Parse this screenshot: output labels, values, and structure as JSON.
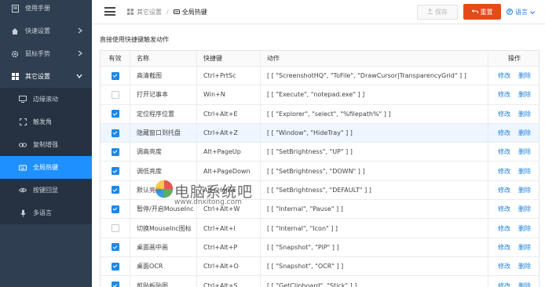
{
  "sidebar": {
    "items": [
      {
        "label": "使用手册",
        "icon": "document-icon",
        "level": "top"
      },
      {
        "label": "快速设置",
        "icon": "home-icon",
        "level": "top",
        "caret": "chevron-right-icon"
      },
      {
        "label": "鼠标手势",
        "icon": "gear-icon",
        "level": "top",
        "caret": "chevron-right-icon"
      },
      {
        "label": "其它设置",
        "icon": "grid-icon",
        "level": "top",
        "caret": "chevron-down-icon",
        "open": true
      },
      {
        "label": "边缘滚动",
        "icon": "monitor-icon",
        "level": "sub"
      },
      {
        "label": "触发角",
        "icon": "corners-icon",
        "level": "sub"
      },
      {
        "label": "复制增强",
        "icon": "link-icon",
        "level": "sub"
      },
      {
        "label": "全局热键",
        "icon": "keyboard-icon",
        "level": "sub",
        "active": true
      },
      {
        "label": "按键回显",
        "icon": "eye-icon",
        "level": "sub"
      },
      {
        "label": "多语言",
        "icon": "microphone-icon",
        "level": "sub"
      }
    ]
  },
  "header": {
    "breadcrumb_parent": "其它设置",
    "breadcrumb_sep": "/",
    "breadcrumb_current": "全局热键",
    "save_label": "保存",
    "reset_label": "重置",
    "lang_label": "语言"
  },
  "main": {
    "description": "直接使用快捷键触发动作",
    "columns": [
      "有效",
      "名称",
      "快捷键",
      "动作",
      "操作"
    ],
    "edit_label": "修改",
    "delete_label": "删除",
    "rows": [
      {
        "enabled": true,
        "name": "高清截图",
        "key": "Ctrl+PrtSc",
        "action": "[ [ \"ScreenshotHQ\", \"ToFile\", \"DrawCursor|TransparencyGrid\" ] ]"
      },
      {
        "enabled": false,
        "name": "打开记事本",
        "key": "Win+N",
        "action": "[ [ \"Execute\", \"notepad.exe\" ] ]"
      },
      {
        "enabled": true,
        "name": "定位程序位置",
        "key": "Ctrl+Alt+E",
        "action": "[ [ \"Explorer\", \"select\", \"%filepath%\" ] ]"
      },
      {
        "enabled": true,
        "name": "隐藏窗口到托盘",
        "key": "Ctrl+Alt+Z",
        "action": "[ [ \"Window\", \"HideTray\" ] ]",
        "highlight": true
      },
      {
        "enabled": true,
        "name": "调高亮度",
        "key": "Alt+PageUp",
        "action": "[ [ \"SetBrightness\", \"UP\" ] ]"
      },
      {
        "enabled": true,
        "name": "调低亮度",
        "key": "Alt+PageDown",
        "action": "[ [ \"SetBrightness\", \"DOWN\" ] ]"
      },
      {
        "enabled": true,
        "name": "默认亮度",
        "key": "Alt+Home",
        "action": "[ [ \"SetBrightness\", \"DEFAULT\" ] ]"
      },
      {
        "enabled": true,
        "name": "暂停/开启MouseInc",
        "key": "Ctrl+Alt+W",
        "action": "[ [ \"Internal\", \"Pause\" ] ]"
      },
      {
        "enabled": false,
        "name": "切换MouseInc图标",
        "key": "Ctrl+Alt+I",
        "action": "[ [ \"Internal\", \"Icon\" ] ]"
      },
      {
        "enabled": true,
        "name": "桌面画中画",
        "key": "Ctrl+Alt+P",
        "action": "[ [ \"Snapshot\", \"PiP\" ] ]"
      },
      {
        "enabled": true,
        "name": "桌面OCR",
        "key": "Ctrl+Alt+O",
        "action": "[ [ \"Snapshot\", \"OCR\" ] ]"
      },
      {
        "enabled": true,
        "name": "剪贴板贴图",
        "key": "Ctrl+Alt+S",
        "action": "[ [ \"GetClipboard\", \"Stick\" ] ]"
      }
    ]
  },
  "watermark": {
    "text": "电脑系统吧",
    "url": "www.dnxitong.com"
  },
  "colors": {
    "sidebar_bg": "#2f3e50",
    "active_nav": "#1e90ff",
    "reset_btn": "#e64a19",
    "link": "#1e7fd8",
    "checkbox": "#1e88e5"
  }
}
